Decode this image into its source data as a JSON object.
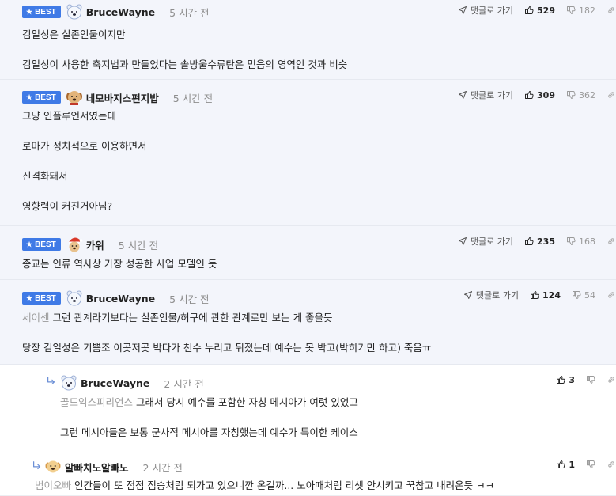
{
  "labels": {
    "best": "BEST",
    "reply_go": "댓글로 가기"
  },
  "comments": [
    {
      "nick": "BruceWayne",
      "time": "5 시간 전",
      "up": "529",
      "down": "182",
      "lines": [
        "김일성은 실존인물이지만",
        "",
        "김일성이 사용한 축지법과 만들었다는 솔방울수류탄은 믿음의 영역인 것과 비슷"
      ]
    },
    {
      "nick": "네모바지스펀지밥",
      "time": "5 시간 전",
      "up": "309",
      "down": "362",
      "lines": [
        "그냥 인플루언서였는데",
        "",
        "로마가 정치적으로 이용하면서",
        "",
        "신격화돼서",
        "",
        "영향력이 커진거아님?"
      ]
    },
    {
      "nick": "카위",
      "time": "5 시간 전",
      "up": "235",
      "down": "168",
      "lines": [
        "종교는 인류 역사상 가장 성공한 사업 모델인 듯"
      ]
    },
    {
      "nick": "BruceWayne",
      "time": "5 시간 전",
      "up": "124",
      "down": "54",
      "mention": "세이센",
      "line1": "그런 관계라기보다는 실존인물/허구에 관한 관계로만 보는 게 좋을듯",
      "line2": "당장 김일성은 기쁨조 이곳저곳 박다가 천수 누리고 뒤졌는데 예수는 못 박고(박히기만 하고) 죽음ㅠ"
    },
    {
      "nick": "BruceWayne",
      "time": "2 시간 전",
      "up": "3",
      "mention": "골드익스피리언스",
      "line1": "그래서 당시 예수를 포함한 자칭 메시아가 여럿 있었고",
      "line2": "그런 메시아들은 보통 군사적 메시아를 자칭했는데 예수가 특이한 케이스"
    },
    {
      "nick": "알빠치노알빠노",
      "time": "2 시간 전",
      "up": "1",
      "mention": "범이오빠",
      "line1": "인간들이 또 점점 짐승처럼 되가고 있으니깐 온걸까... 노아때처럼 리셋 안시키고 꾹참고 내려온듯 ㅋㅋ"
    }
  ],
  "icons": {
    "avatar_1": "polar-bear-avatar",
    "avatar_2": "puppy-avatar",
    "avatar_3": "santa-dog-avatar",
    "avatar_6": "golden-puppy-avatar",
    "thumbs_up": "thumbs-up-icon",
    "thumbs_down": "thumbs-down-icon",
    "link": "link-icon",
    "reply_arrow": "reply-arrow-icon",
    "send": "send-icon"
  },
  "colors": {
    "best_badge": "#3f7ae6",
    "highlight_bg": "#f3f5fb",
    "mention": "#9a9a9a"
  }
}
